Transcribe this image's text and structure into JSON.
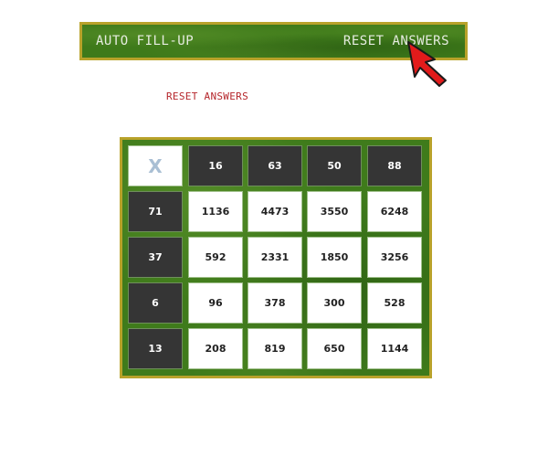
{
  "toolbar": {
    "auto_fill_label": "AUTO FILL-UP",
    "reset_answers_label": "RESET ANSWERS"
  },
  "reset_link_label": "RESET ANSWERS",
  "table": {
    "corner": "X",
    "column_headers": [
      "16",
      "63",
      "50",
      "88"
    ],
    "rows": [
      {
        "header": "71",
        "cells": [
          "1136",
          "4473",
          "3550",
          "6248"
        ]
      },
      {
        "header": "37",
        "cells": [
          "592",
          "2331",
          "1850",
          "3256"
        ]
      },
      {
        "header": "6",
        "cells": [
          "96",
          "378",
          "300",
          "528"
        ]
      },
      {
        "header": "13",
        "cells": [
          "208",
          "819",
          "650",
          "1144"
        ]
      }
    ]
  },
  "colors": {
    "board_green": "#3f7b1b",
    "border_gold": "#b8a22a",
    "header_dark": "#353535",
    "reset_red": "#b5262b",
    "cursor_red": "#e21b1b"
  },
  "icons": {
    "cursor": "arrow-cursor-icon",
    "corner": "x-icon"
  }
}
